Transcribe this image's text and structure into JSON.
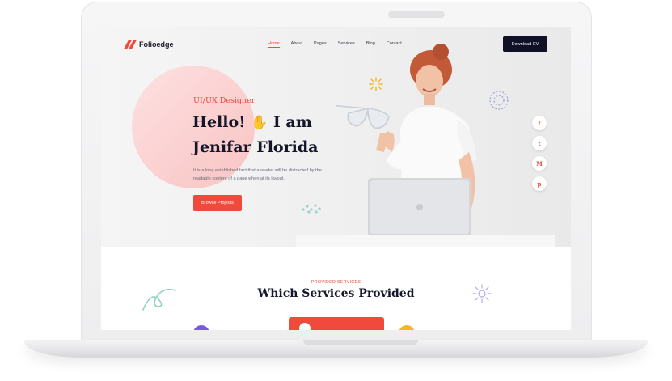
{
  "brand": {
    "name": "Folioedge"
  },
  "nav": {
    "links": [
      "Home",
      "About",
      "Pages",
      "Services",
      "Blog",
      "Contact"
    ],
    "active": "Home",
    "cta_label": "Download CV"
  },
  "hero": {
    "eyebrow": "UI/UX Designer",
    "greeting": "Hello!",
    "hand_emoji": "✋",
    "greeting_suffix": "I am",
    "name": "Jenifar Florida",
    "description": "It is a long established fact that a reader will be distracted by the readable content of a page when at its layout.",
    "button_label": "Browse Projects"
  },
  "social": {
    "items": [
      {
        "name": "facebook-icon",
        "glyph": "f"
      },
      {
        "name": "twitter-icon",
        "glyph": "t"
      },
      {
        "name": "medium-icon",
        "glyph": "M"
      },
      {
        "name": "pinterest-icon",
        "glyph": "p"
      }
    ]
  },
  "services": {
    "eyebrow": "PROVIDED SERVICES",
    "title": "Which Services Provided"
  },
  "colors": {
    "accent": "#ef4a3c",
    "dark": "#101126",
    "hero_circle": "#fbcfcf",
    "purple": "#7b57e8",
    "yellow": "#f5b623"
  }
}
